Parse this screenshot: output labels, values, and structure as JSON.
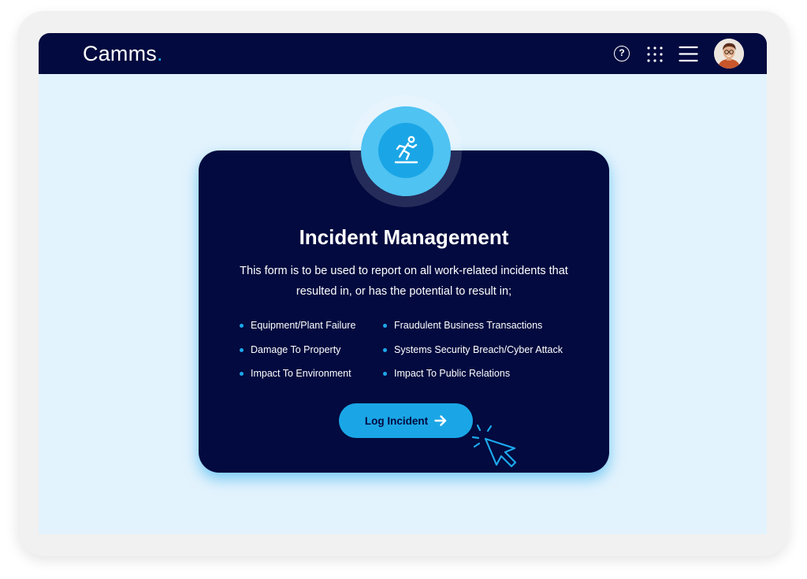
{
  "header": {
    "logo_text": "Camms",
    "logo_dot": ".",
    "icons": [
      "help-icon",
      "apps-grid-icon",
      "hamburger-menu-icon",
      "user-avatar"
    ]
  },
  "card": {
    "badge_icon": "falling-person-icon",
    "title": "Incident Management",
    "description": "This form is to be used to report on all work-related incidents that resulted in, or has the potential to result in;",
    "items_left": [
      "Equipment/Plant Failure",
      "Damage To Property",
      "Impact To Environment"
    ],
    "items_right": [
      "Fraudulent Business Transactions",
      "Systems Security Breach/Cyber Attack",
      "Impact To Public Relations"
    ],
    "button_label": "Log Incident",
    "button_icon": "arrow-right-icon",
    "cursor_icon": "pointer-click-icon"
  },
  "colors": {
    "navy": "#020a3f",
    "accent": "#1da8ec",
    "background": "#e3f3fd",
    "device_frame": "#f1f1f1"
  }
}
